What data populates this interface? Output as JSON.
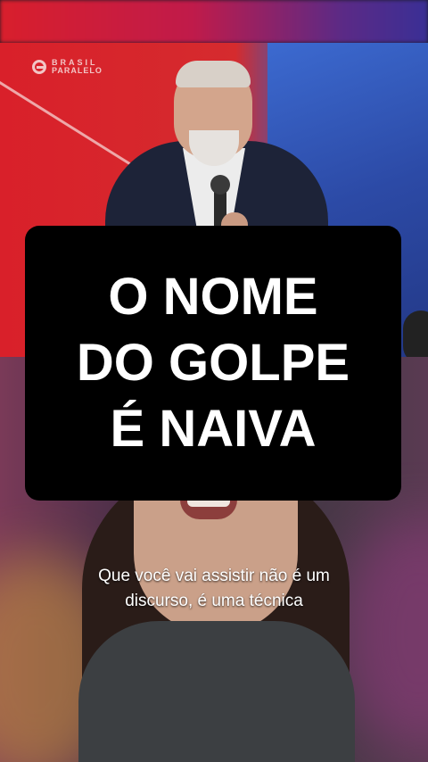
{
  "video": {
    "watermark": {
      "line1": "BRASIL",
      "line2": "PARALELO",
      "icon": "brasil-paralelo-logo-icon"
    }
  },
  "title_card": {
    "lines": [
      "O NOME",
      "DO GOLPE",
      "É NAIVA"
    ]
  },
  "caption": {
    "text": "Que você vai assistir não é um discurso, é uma técnica"
  },
  "colors": {
    "title_bg": "#000000",
    "title_text": "#ffffff",
    "stage_red": "#d9202a",
    "stage_blue": "#3c6ad0"
  }
}
